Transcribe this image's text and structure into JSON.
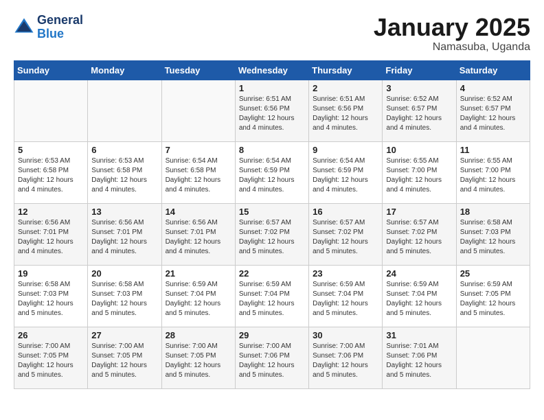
{
  "logo": {
    "line1": "General",
    "line2": "Blue"
  },
  "title": "January 2025",
  "subtitle": "Namasuba, Uganda",
  "days_of_week": [
    "Sunday",
    "Monday",
    "Tuesday",
    "Wednesday",
    "Thursday",
    "Friday",
    "Saturday"
  ],
  "weeks": [
    [
      {
        "day": "",
        "content": ""
      },
      {
        "day": "",
        "content": ""
      },
      {
        "day": "",
        "content": ""
      },
      {
        "day": "1",
        "content": "Sunrise: 6:51 AM\nSunset: 6:56 PM\nDaylight: 12 hours\nand 4 minutes."
      },
      {
        "day": "2",
        "content": "Sunrise: 6:51 AM\nSunset: 6:56 PM\nDaylight: 12 hours\nand 4 minutes."
      },
      {
        "day": "3",
        "content": "Sunrise: 6:52 AM\nSunset: 6:57 PM\nDaylight: 12 hours\nand 4 minutes."
      },
      {
        "day": "4",
        "content": "Sunrise: 6:52 AM\nSunset: 6:57 PM\nDaylight: 12 hours\nand 4 minutes."
      }
    ],
    [
      {
        "day": "5",
        "content": "Sunrise: 6:53 AM\nSunset: 6:58 PM\nDaylight: 12 hours\nand 4 minutes."
      },
      {
        "day": "6",
        "content": "Sunrise: 6:53 AM\nSunset: 6:58 PM\nDaylight: 12 hours\nand 4 minutes."
      },
      {
        "day": "7",
        "content": "Sunrise: 6:54 AM\nSunset: 6:58 PM\nDaylight: 12 hours\nand 4 minutes."
      },
      {
        "day": "8",
        "content": "Sunrise: 6:54 AM\nSunset: 6:59 PM\nDaylight: 12 hours\nand 4 minutes."
      },
      {
        "day": "9",
        "content": "Sunrise: 6:54 AM\nSunset: 6:59 PM\nDaylight: 12 hours\nand 4 minutes."
      },
      {
        "day": "10",
        "content": "Sunrise: 6:55 AM\nSunset: 7:00 PM\nDaylight: 12 hours\nand 4 minutes."
      },
      {
        "day": "11",
        "content": "Sunrise: 6:55 AM\nSunset: 7:00 PM\nDaylight: 12 hours\nand 4 minutes."
      }
    ],
    [
      {
        "day": "12",
        "content": "Sunrise: 6:56 AM\nSunset: 7:01 PM\nDaylight: 12 hours\nand 4 minutes."
      },
      {
        "day": "13",
        "content": "Sunrise: 6:56 AM\nSunset: 7:01 PM\nDaylight: 12 hours\nand 4 minutes."
      },
      {
        "day": "14",
        "content": "Sunrise: 6:56 AM\nSunset: 7:01 PM\nDaylight: 12 hours\nand 4 minutes."
      },
      {
        "day": "15",
        "content": "Sunrise: 6:57 AM\nSunset: 7:02 PM\nDaylight: 12 hours\nand 5 minutes."
      },
      {
        "day": "16",
        "content": "Sunrise: 6:57 AM\nSunset: 7:02 PM\nDaylight: 12 hours\nand 5 minutes."
      },
      {
        "day": "17",
        "content": "Sunrise: 6:57 AM\nSunset: 7:02 PM\nDaylight: 12 hours\nand 5 minutes."
      },
      {
        "day": "18",
        "content": "Sunrise: 6:58 AM\nSunset: 7:03 PM\nDaylight: 12 hours\nand 5 minutes."
      }
    ],
    [
      {
        "day": "19",
        "content": "Sunrise: 6:58 AM\nSunset: 7:03 PM\nDaylight: 12 hours\nand 5 minutes."
      },
      {
        "day": "20",
        "content": "Sunrise: 6:58 AM\nSunset: 7:03 PM\nDaylight: 12 hours\nand 5 minutes."
      },
      {
        "day": "21",
        "content": "Sunrise: 6:59 AM\nSunset: 7:04 PM\nDaylight: 12 hours\nand 5 minutes."
      },
      {
        "day": "22",
        "content": "Sunrise: 6:59 AM\nSunset: 7:04 PM\nDaylight: 12 hours\nand 5 minutes."
      },
      {
        "day": "23",
        "content": "Sunrise: 6:59 AM\nSunset: 7:04 PM\nDaylight: 12 hours\nand 5 minutes."
      },
      {
        "day": "24",
        "content": "Sunrise: 6:59 AM\nSunset: 7:04 PM\nDaylight: 12 hours\nand 5 minutes."
      },
      {
        "day": "25",
        "content": "Sunrise: 6:59 AM\nSunset: 7:05 PM\nDaylight: 12 hours\nand 5 minutes."
      }
    ],
    [
      {
        "day": "26",
        "content": "Sunrise: 7:00 AM\nSunset: 7:05 PM\nDaylight: 12 hours\nand 5 minutes."
      },
      {
        "day": "27",
        "content": "Sunrise: 7:00 AM\nSunset: 7:05 PM\nDaylight: 12 hours\nand 5 minutes."
      },
      {
        "day": "28",
        "content": "Sunrise: 7:00 AM\nSunset: 7:05 PM\nDaylight: 12 hours\nand 5 minutes."
      },
      {
        "day": "29",
        "content": "Sunrise: 7:00 AM\nSunset: 7:06 PM\nDaylight: 12 hours\nand 5 minutes."
      },
      {
        "day": "30",
        "content": "Sunrise: 7:00 AM\nSunset: 7:06 PM\nDaylight: 12 hours\nand 5 minutes."
      },
      {
        "day": "31",
        "content": "Sunrise: 7:01 AM\nSunset: 7:06 PM\nDaylight: 12 hours\nand 5 minutes."
      },
      {
        "day": "",
        "content": ""
      }
    ]
  ]
}
